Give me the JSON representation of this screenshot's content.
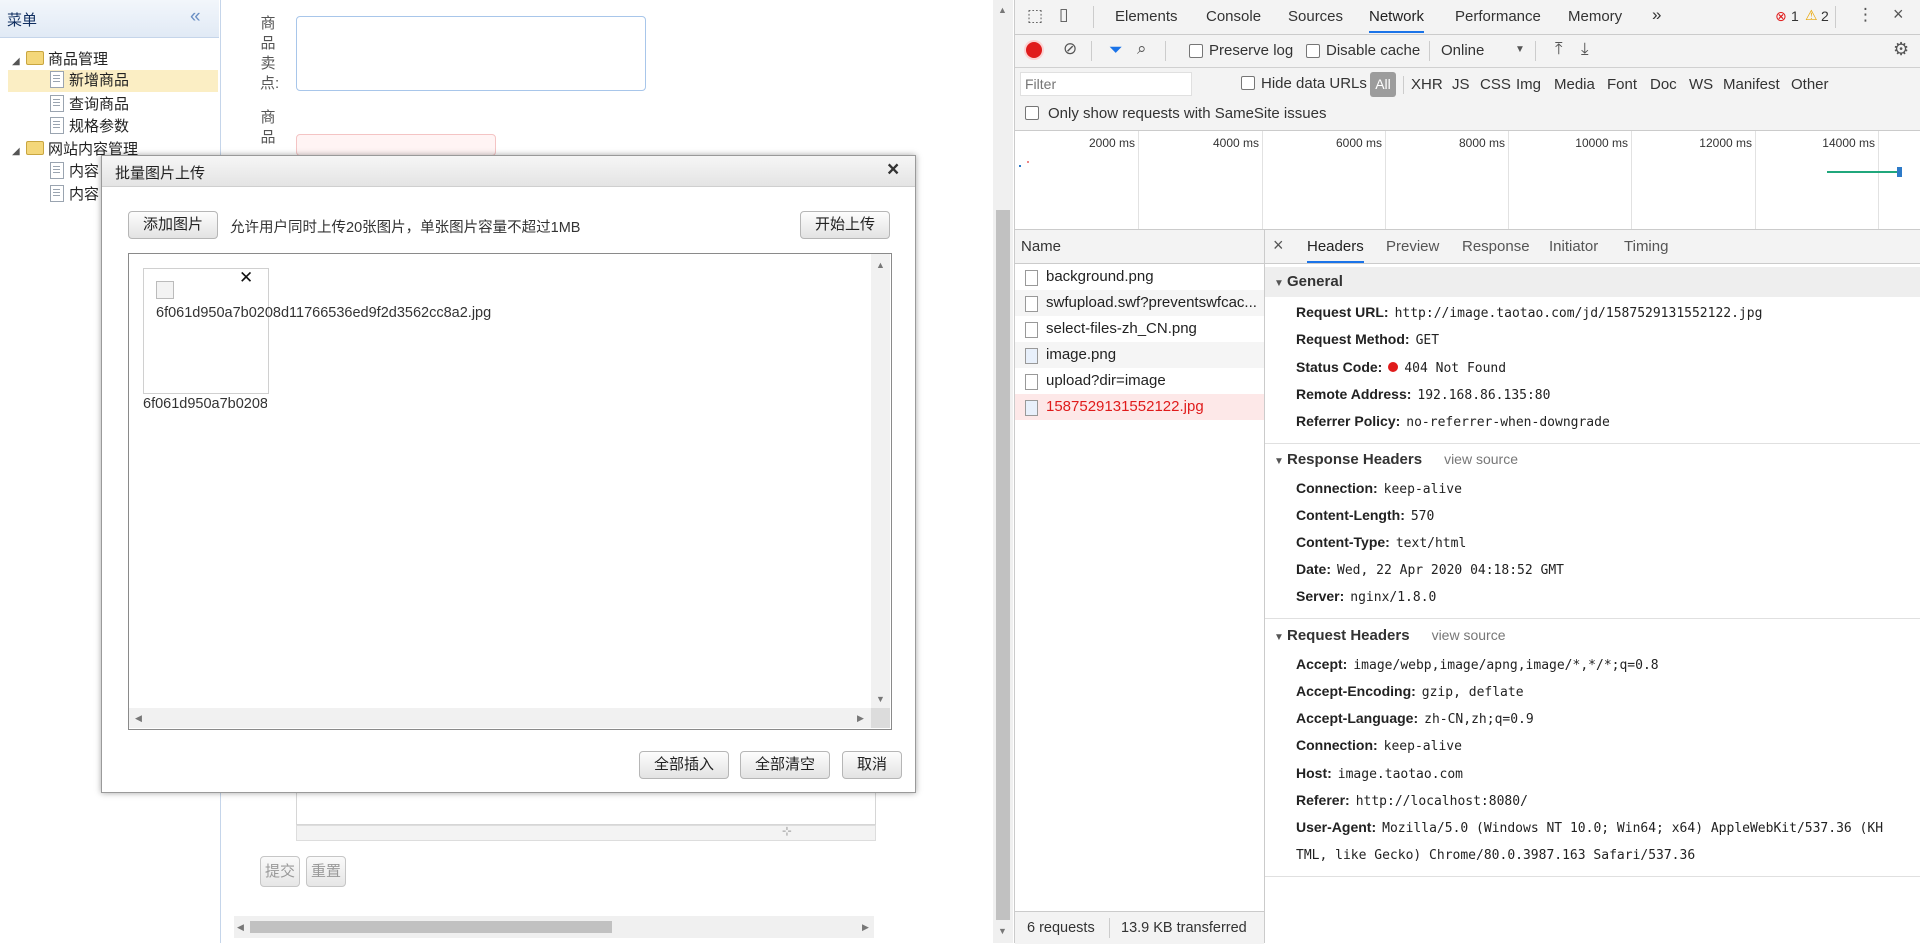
{
  "sidebar": {
    "title": "菜单",
    "tree": [
      {
        "label": "商品管理",
        "type": "folder"
      },
      {
        "label": "新增商品",
        "type": "file",
        "selected": true
      },
      {
        "label": "查询商品",
        "type": "file"
      },
      {
        "label": "规格参数",
        "type": "file"
      },
      {
        "label": "网站内容管理",
        "type": "folder"
      },
      {
        "label": "内容",
        "type": "file"
      },
      {
        "label": "内容",
        "type": "file"
      }
    ]
  },
  "form": {
    "label_selling_point": "商品卖点:",
    "label_price": "商品",
    "submit_label": "提交",
    "reset_label": "重置"
  },
  "dialog": {
    "title": "批量图片上传",
    "add_button": "添加图片",
    "hint": "允许用户同时上传20张图片，单张图片容量不超过1MB",
    "start_button": "开始上传",
    "image_alt": "6f061d950a7b0208d11766536ed9f2d3562cc8a2.jpg",
    "image_name": "6f061d950a7b0208d11766536ed9f2d3562cc8a2.jpg",
    "insert_all": "全部插入",
    "clear_all": "全部清空",
    "cancel": "取消"
  },
  "devtools": {
    "tabs": [
      "Elements",
      "Console",
      "Sources",
      "Network",
      "Performance",
      "Memory"
    ],
    "active_tab": "Network",
    "error_count": "1",
    "warning_count": "2",
    "toolbar": {
      "preserve_log": "Preserve log",
      "disable_cache": "Disable cache",
      "throttle": "Online"
    },
    "filter": {
      "placeholder": "Filter",
      "hide_data_urls": "Hide data URLs",
      "types": [
        "All",
        "XHR",
        "JS",
        "CSS",
        "Img",
        "Media",
        "Font",
        "Doc",
        "WS",
        "Manifest",
        "Other"
      ],
      "samesite": "Only show requests with SameSite issues"
    },
    "timeline_ticks": [
      "2000 ms",
      "4000 ms",
      "6000 ms",
      "8000 ms",
      "10000 ms",
      "12000 ms",
      "14000 ms"
    ],
    "name_header": "Name",
    "requests": [
      {
        "name": "background.png",
        "error": false
      },
      {
        "name": "swfupload.swf?preventswfcac...",
        "error": false
      },
      {
        "name": "select-files-zh_CN.png",
        "error": false
      },
      {
        "name": "image.png",
        "error": false
      },
      {
        "name": "upload?dir=image",
        "error": false
      },
      {
        "name": "1587529131552122.jpg",
        "error": true
      }
    ],
    "status": {
      "requests": "6 requests",
      "transferred": "13.9 KB transferred"
    },
    "detail_tabs": [
      "Headers",
      "Preview",
      "Response",
      "Initiator",
      "Timing"
    ],
    "general": {
      "title": "General",
      "rows": [
        {
          "k": "Request URL:",
          "v": "http://image.taotao.com/jd/1587529131552122.jpg"
        },
        {
          "k": "Request Method:",
          "v": "GET"
        },
        {
          "k": "Status Code:",
          "v": "404 Not Found"
        },
        {
          "k": "Remote Address:",
          "v": "192.168.86.135:80"
        },
        {
          "k": "Referrer Policy:",
          "v": "no-referrer-when-downgrade"
        }
      ]
    },
    "response_headers": {
      "title": "Response Headers",
      "view_source": "view source",
      "rows": [
        {
          "k": "Connection:",
          "v": "keep-alive"
        },
        {
          "k": "Content-Length:",
          "v": "570"
        },
        {
          "k": "Content-Type:",
          "v": "text/html"
        },
        {
          "k": "Date:",
          "v": "Wed, 22 Apr 2020 04:18:52 GMT"
        },
        {
          "k": "Server:",
          "v": "nginx/1.8.0"
        }
      ]
    },
    "request_headers": {
      "title": "Request Headers",
      "view_source": "view source",
      "rows": [
        {
          "k": "Accept:",
          "v": "image/webp,image/apng,image/*,*/*;q=0.8"
        },
        {
          "k": "Accept-Encoding:",
          "v": "gzip, deflate"
        },
        {
          "k": "Accept-Language:",
          "v": "zh-CN,zh;q=0.9"
        },
        {
          "k": "Connection:",
          "v": "keep-alive"
        },
        {
          "k": "Host:",
          "v": "image.taotao.com"
        },
        {
          "k": "Referer:",
          "v": "http://localhost:8080/"
        },
        {
          "k": "User-Agent:",
          "v": "Mozilla/5.0 (Windows NT 10.0; Win64; x64) AppleWebKit/537.36 (KH"
        },
        {
          "k": "",
          "v": "TML, like Gecko) Chrome/80.0.3987.163 Safari/537.36"
        }
      ]
    }
  },
  "colors": {
    "accent": "#1a73e8",
    "error": "#e01b1b",
    "sidebar_selected": "#fbeec4",
    "sidebar_title": "#0e2d5f"
  }
}
